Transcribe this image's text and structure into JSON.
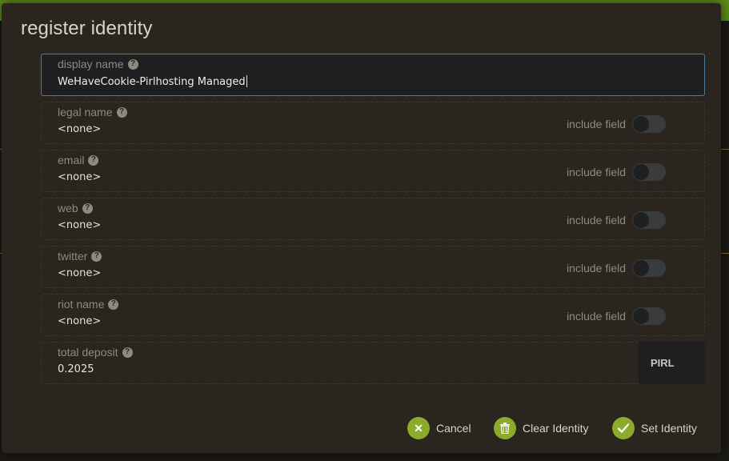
{
  "modal": {
    "title": "register identity"
  },
  "fields": [
    {
      "label": "display name",
      "value": "WeHaveCookie-Pirlhosting Managed",
      "has_toggle": false,
      "active": true
    },
    {
      "label": "legal name",
      "value": "<none>",
      "toggle_label": "include field",
      "toggle_on": false
    },
    {
      "label": "email",
      "value": "<none>",
      "toggle_label": "include field",
      "toggle_on": false
    },
    {
      "label": "web",
      "value": "<none>",
      "toggle_label": "include field",
      "toggle_on": false
    },
    {
      "label": "twitter",
      "value": "<none>",
      "toggle_label": "include field",
      "toggle_on": false
    },
    {
      "label": "riot name",
      "value": "<none>",
      "toggle_label": "include field",
      "toggle_on": false
    },
    {
      "label": "total deposit",
      "value": "0.2025",
      "unit": "PIRL"
    }
  ],
  "buttons": {
    "cancel": "Cancel",
    "clear": "Clear Identity",
    "set": "Set Identity"
  },
  "icons": {
    "help": "help-circle-icon",
    "cancel": "close-icon",
    "clear": "trash-icon",
    "set": "checkmark-icon"
  },
  "colors": {
    "accent": "#8bab2a",
    "topbar": "#5c8a1a",
    "modal_bg": "#2a251f",
    "active_border": "#4f7b96"
  }
}
